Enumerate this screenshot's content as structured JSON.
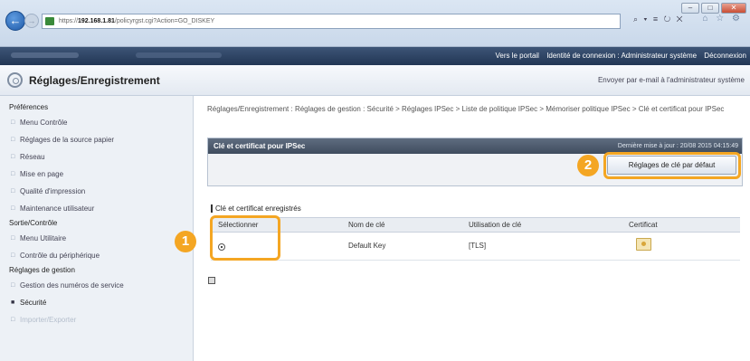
{
  "browser": {
    "address_prefix": "https://",
    "address_host": "192.168.1.81",
    "address_path": "/policyrgst.cgi?Action=GO_DISKEY",
    "addr_tools": "⌕ ▾ ≡ ↻ ✕",
    "fav_tools": "⌂ ☆ ⚙",
    "win_min": "–",
    "win_max": "□",
    "win_close": "✕",
    "back_arrow": "←",
    "fwd_arrow": "→"
  },
  "topbar": {
    "portal_link": "Vers le portail",
    "identity_label": "Identité de connexion : Administrateur système",
    "logout_link": "Déconnexion"
  },
  "header": {
    "title": "Réglages/Enregistrement",
    "email_link": "Envoyer par e-mail à l'administrateur système"
  },
  "sidebar": {
    "groups": [
      {
        "label": "Préférences",
        "items": [
          {
            "label": "Menu Contrôle"
          },
          {
            "label": "Réglages de la source papier"
          },
          {
            "label": "Réseau"
          },
          {
            "label": "Mise en page"
          },
          {
            "label": "Qualité d'impression"
          },
          {
            "label": "Maintenance utilisateur"
          }
        ]
      },
      {
        "label": "Sortie/Contrôle",
        "items": [
          {
            "label": "Menu Utilitaire"
          },
          {
            "label": "Contrôle du périphérique"
          }
        ]
      },
      {
        "label": "Réglages de gestion",
        "items": [
          {
            "label": "Gestion des numéros de service"
          },
          {
            "label": "Sécurité"
          },
          {
            "label": "Importer/Exporter"
          }
        ]
      }
    ]
  },
  "main": {
    "breadcrumb": "Réglages/Enregistrement : Réglages de gestion : Sécurité > Réglages IPSec > Liste de politique IPSec > Mémoriser politique IPSec > Clé et certificat pour IPSec",
    "panel_title": "Clé et certificat pour IPSec",
    "last_updated": "Dernière mise à jour : 20/08 2015 04:15:49",
    "default_key_button": "Réglages de clé par défaut",
    "section_title": "Clé et certificat enregistrés",
    "table": {
      "columns": [
        "Sélectionner",
        "Nom de clé",
        "Utilisation de clé",
        "Certificat"
      ],
      "rows": [
        {
          "key_name": "Default Key",
          "usage": "[TLS]",
          "selected": true
        }
      ]
    }
  },
  "callouts": [
    "1",
    "2"
  ],
  "colors": {
    "accent": "#f4a623",
    "header_dark": "#2b3f5f"
  }
}
